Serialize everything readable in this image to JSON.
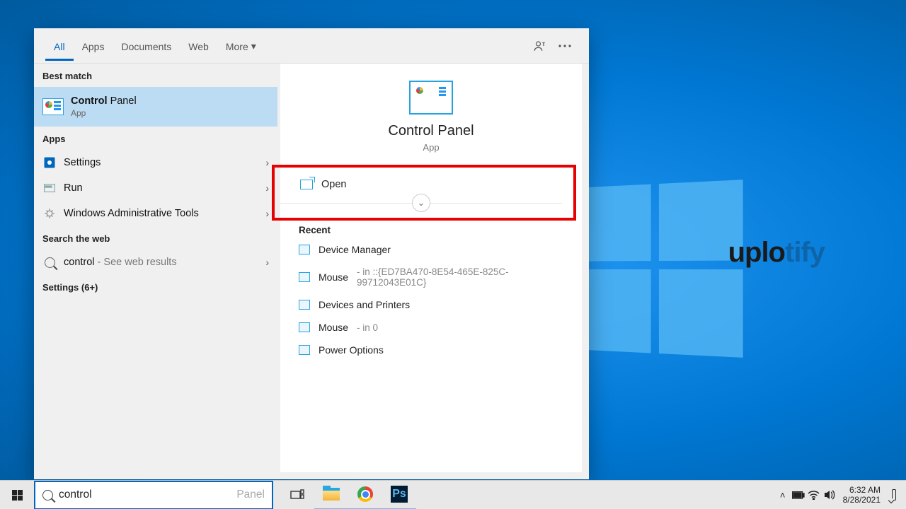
{
  "tabs": {
    "all": "All",
    "apps": "Apps",
    "documents": "Documents",
    "web": "Web",
    "more": "More"
  },
  "sections": {
    "bestMatch": "Best match",
    "apps": "Apps",
    "searchWeb": "Search the web",
    "settingsCount": "Settings (6+)"
  },
  "bestMatch": {
    "titleBold": "Control",
    "titleRest": " Panel",
    "subtitle": "App"
  },
  "appsList": {
    "settings": "Settings",
    "run": "Run",
    "adminTools": "Windows Administrative Tools"
  },
  "webSearch": {
    "query": "control",
    "suffix": " - See web results"
  },
  "detail": {
    "title": "Control Panel",
    "subtitle": "App",
    "openLabel": "Open"
  },
  "recent": {
    "header": "Recent",
    "items": [
      {
        "label": "Device Manager",
        "suffix": ""
      },
      {
        "label": "Mouse",
        "suffix": " - in ::{ED7BA470-8E54-465E-825C-99712043E01C}"
      },
      {
        "label": "Devices and Printers",
        "suffix": ""
      },
      {
        "label": "Mouse",
        "suffix": " - in 0"
      },
      {
        "label": "Power Options",
        "suffix": ""
      }
    ]
  },
  "search": {
    "typed": "control",
    "ghost": " Panel"
  },
  "tray": {
    "time": "6:32 AM",
    "date": "8/28/2021"
  },
  "watermark": {
    "text": "uplo",
    "faded": "tify"
  }
}
